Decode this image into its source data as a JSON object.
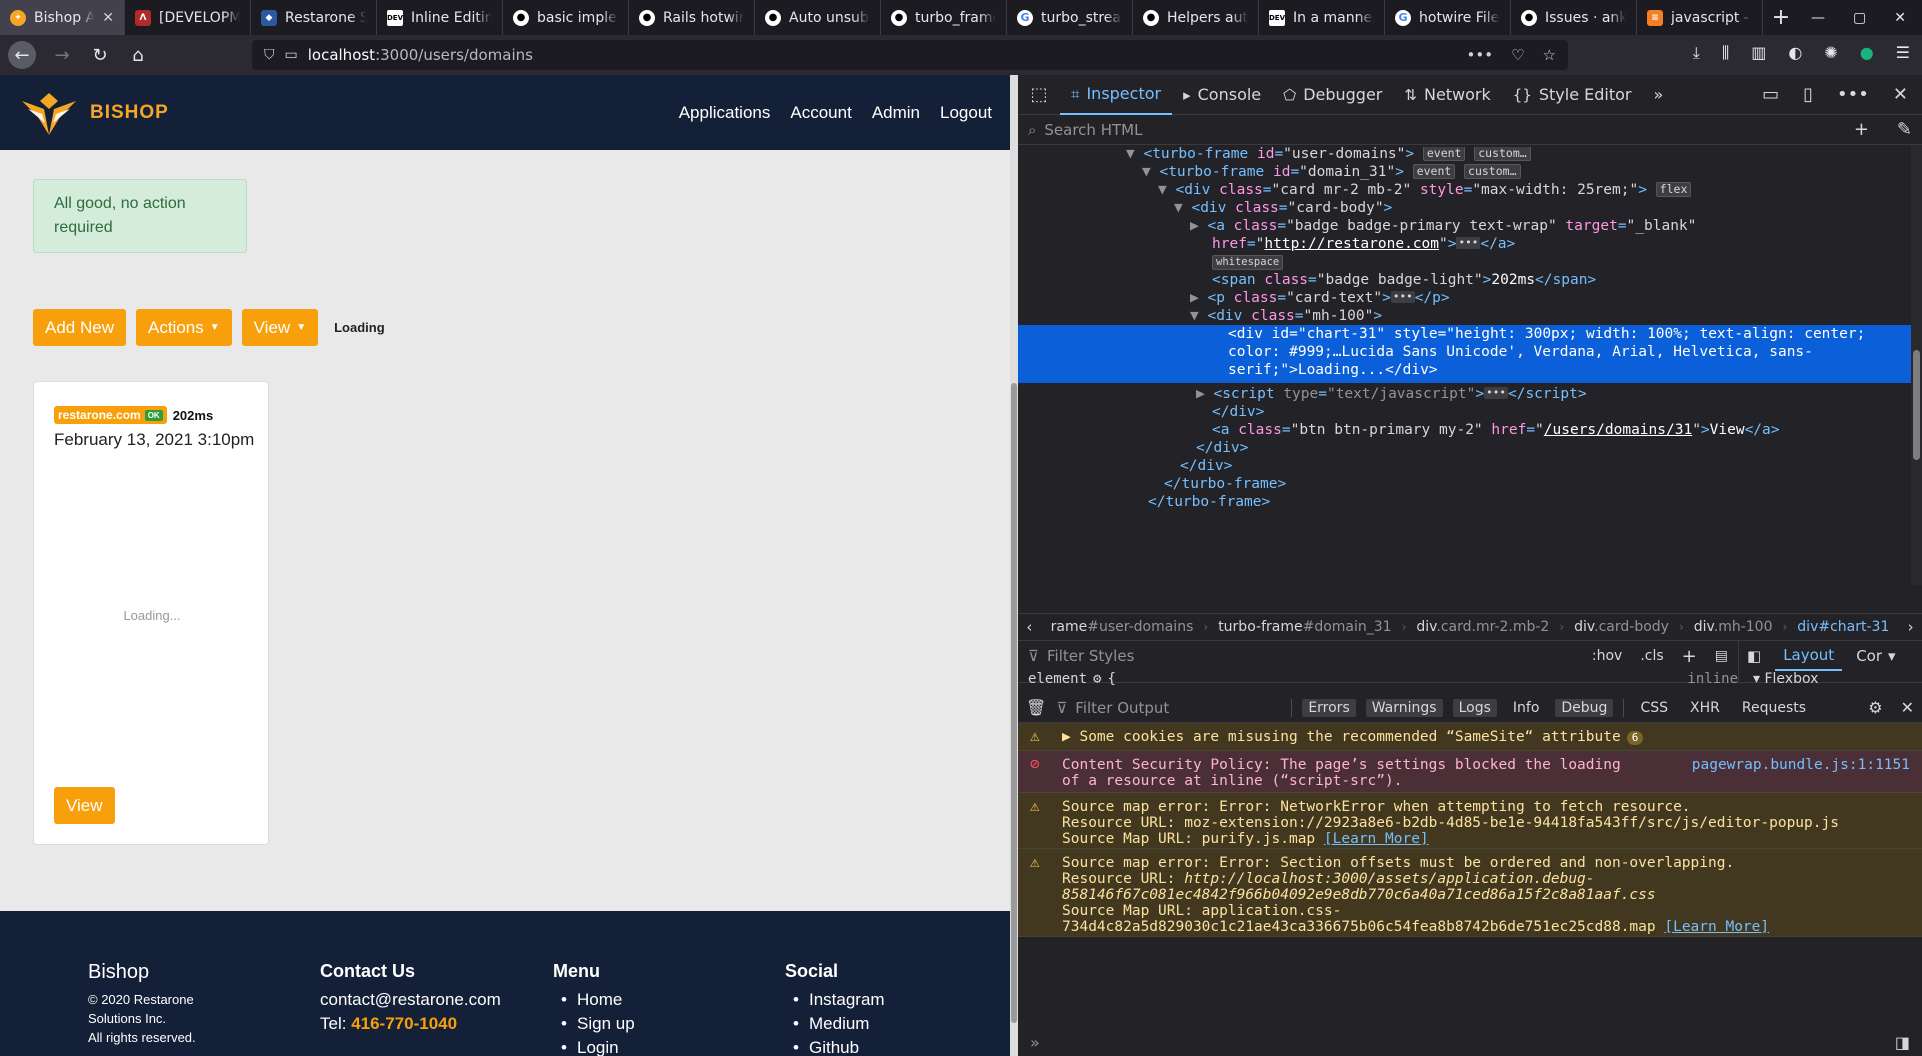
{
  "browser": {
    "tabs": [
      {
        "title": "Bishop Ap",
        "favicon": "bishop",
        "active": true
      },
      {
        "title": "[DEVELOPM",
        "favicon": "red",
        "active": false
      },
      {
        "title": "Restarone S",
        "favicon": "shield",
        "active": false
      },
      {
        "title": "Inline Editin",
        "favicon": "dev",
        "active": false
      },
      {
        "title": "basic implen",
        "favicon": "gh",
        "active": false
      },
      {
        "title": "Rails hotwir",
        "favicon": "gh",
        "active": false
      },
      {
        "title": "Auto unsubs",
        "favicon": "gh",
        "active": false
      },
      {
        "title": "turbo_frame",
        "favicon": "gh",
        "active": false
      },
      {
        "title": "turbo_strea",
        "favicon": "goog",
        "active": false
      },
      {
        "title": "Helpers aut",
        "favicon": "gh",
        "active": false
      },
      {
        "title": "In a manner",
        "favicon": "dev",
        "active": false
      },
      {
        "title": "hotwire File",
        "favicon": "goog",
        "active": false
      },
      {
        "title": "Issues · anka",
        "favicon": "gh",
        "active": false
      },
      {
        "title": "javascript - \\",
        "favicon": "js",
        "active": false
      }
    ],
    "url_host": "localhost",
    "url_rest": ":3000/users/domains"
  },
  "site": {
    "brand": "BISHOP",
    "nav": [
      "Applications",
      "Account",
      "Admin",
      "Logout"
    ],
    "alert": "All good, no action required",
    "buttons": {
      "add_new": "Add New",
      "actions": "Actions",
      "view": "View"
    },
    "loading_label": "Loading",
    "card": {
      "domain": "restarone.com",
      "ok_badge": "OK",
      "latency": "202ms",
      "date": "February 13, 2021 3:10pm",
      "chart_loading": "Loading...",
      "view_button": "View"
    },
    "footer": {
      "brand": "Bishop",
      "copyright": [
        "© 2020 Restarone",
        "Solutions Inc.",
        "All rights reserved."
      ],
      "contact_title": "Contact Us",
      "email": "contact@restarone.com",
      "tel_label": "Tel: ",
      "tel": "416-770-1040",
      "menu_title": "Menu",
      "menu": [
        "Home",
        "Sign up",
        "Login"
      ],
      "social_title": "Social",
      "social": [
        "Instagram",
        "Medium",
        "Github"
      ]
    }
  },
  "devtools": {
    "tabs": [
      "Inspector",
      "Console",
      "Debugger",
      "Network",
      "Style Editor"
    ],
    "search_placeholder": "Search HTML",
    "breadcrumbs": [
      {
        "tag": "rame",
        "id": "#user-domains"
      },
      {
        "tag": "turbo-frame",
        "id": "#domain_31"
      },
      {
        "tag": "div",
        "id": ".card.mr-2.mb-2"
      },
      {
        "tag": "div",
        "id": ".card-body"
      },
      {
        "tag": "div",
        "id": ".mh-100"
      },
      {
        "tag": "div",
        "id": "#chart-31"
      }
    ],
    "rules_filter": "Filter Styles",
    "rules_tools": {
      "hov": ":hov",
      "cls": ".cls"
    },
    "element_rule": "element",
    "element_display": "inline",
    "layout_tabs": [
      "Layout",
      "Cor"
    ],
    "flexbox_label": "Flexbox",
    "console_filter": "Filter Output",
    "console_levels": [
      "Errors",
      "Warnings",
      "Logs",
      "Info",
      "Debug"
    ],
    "console_types": [
      "CSS",
      "XHR",
      "Requests"
    ],
    "messages": {
      "m1": "Some cookies are misusing the recommended “SameSite“ attribute",
      "m1_count": "6",
      "m2_line1": "Content Security Policy: The page’s settings blocked the loading",
      "m2_line2": "of a resource at inline (“script-src”).",
      "m2_source": "pagewrap.bundle.js:1:1151",
      "m3_line1": "Source map error: Error: NetworkError when attempting to fetch resource.",
      "m3_line2": "Resource URL: moz-extension://2923a8e6-b2db-4d85-be1e-94418fa543ff/src/js/editor-popup.js",
      "m3_line3": "Source Map URL: purify.js.map ",
      "learn_more": "[Learn More]",
      "m4_line1": "Source map error: Error: Section offsets must be ordered and non-overlapping.",
      "m4_line2a": "Resource URL: ",
      "m4_line2b": "http://localhost:3000/assets/application.debug-",
      "m4_line3": "858146f67c081ec4842f966b04092e9e8db770c6a40a71ced86a15f2c8a81aaf.css",
      "m4_line4": "Source Map URL: application.css-",
      "m4_line5": "734d4c82a5d829030c1c21ae43ca336675b06c54fea8b8742b6de751ec25cd88.map "
    }
  }
}
